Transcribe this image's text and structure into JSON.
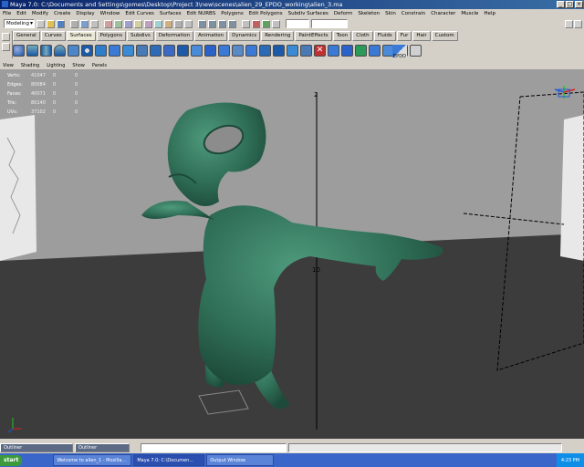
{
  "window": {
    "title": "Maya 7.0: C:\\Documents and Settings\\gomes\\Desktop\\Project 3\\new\\scenes\\alien_29_EPDO_working\\alien_3.ma"
  },
  "menu": [
    "File",
    "Edit",
    "Modify",
    "Create",
    "Display",
    "Window",
    "Edit Curves",
    "Surfaces",
    "Edit NURBS",
    "Polygons",
    "Edit Polygons",
    "Subdiv Surfaces",
    "Deform",
    "Skeleton",
    "Skin",
    "Constrain",
    "Character",
    "Muscle",
    "Help"
  ],
  "status_line": {
    "mode": "Modeling"
  },
  "shelf_tabs": [
    "General",
    "Curves",
    "Surfaces",
    "Polygons",
    "Subdivs",
    "Deformation",
    "Animation",
    "Dynamics",
    "Rendering",
    "PaintEffects",
    "Toon",
    "Cloth",
    "Fluids",
    "Fur",
    "Hair",
    "Custom"
  ],
  "shelf_active": "Surfaces",
  "shelf_epdo": "EPDO",
  "panel_menu": [
    "View",
    "Shading",
    "Lighting",
    "Show",
    "Panels"
  ],
  "hud": [
    {
      "label": "Verts:",
      "a": "41047",
      "b": "0",
      "c": "0"
    },
    {
      "label": "Edges:",
      "a": "80084",
      "b": "0",
      "c": "0"
    },
    {
      "label": "Faces:",
      "a": "40071",
      "b": "0",
      "c": "0"
    },
    {
      "label": "Tris:",
      "a": "80140",
      "b": "0",
      "c": "0"
    },
    {
      "label": "UVs:",
      "a": "37102",
      "b": "0",
      "c": "0"
    }
  ],
  "minimized_panels": [
    "Outliner",
    "Outliner"
  ],
  "taskbar": {
    "start": "start",
    "tasks": [
      "Welcome to alien_1 - Mozilla...",
      "Maya 7.0: C:\\Documen...",
      "Output Window"
    ],
    "clock": "4:23 PM"
  },
  "colors": {
    "model": "#2f6e57",
    "floor": "#3c3c3c",
    "wall": "#9d9d9d",
    "title": "#0a246a"
  }
}
